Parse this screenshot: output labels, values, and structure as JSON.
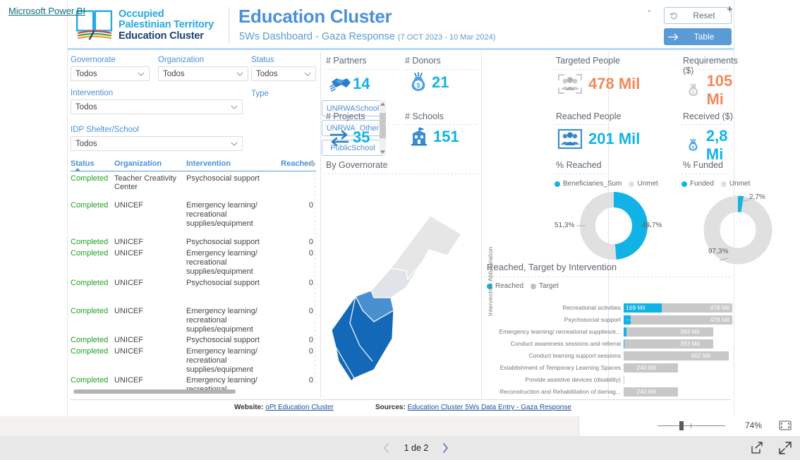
{
  "header": {
    "logo": {
      "line1": "Occupied",
      "line2": "Palestinian Territory",
      "line3": "Education Cluster",
      "icon": "open-book-icon"
    },
    "title": "Education Cluster",
    "subtitle": "5Ws Dashboard - Gaza Response",
    "date_range": "(7 OCT 2023 - 10 Mar 2024)",
    "buttons": {
      "reset": {
        "label": "Reset",
        "icon": "undo-arrow-icon"
      },
      "table": {
        "label": "Table",
        "icon": "right-arrow-icon"
      }
    },
    "colors": {
      "title": "#4a90d9",
      "logo_cyan": "#29a8e0",
      "logo_navy": "#1b3f78"
    }
  },
  "filters": {
    "governorate": {
      "label": "Governorate",
      "value": "Todos"
    },
    "organization": {
      "label": "Organization",
      "value": "Todos"
    },
    "status": {
      "label": "Status",
      "value": "Todos"
    },
    "intervention": {
      "label": "Intervention",
      "value": "Todos"
    },
    "idp_shelter_school": {
      "label": "IDP Shelter/School",
      "value": "Todos"
    },
    "type": {
      "label": "Type",
      "options": [
        "UNRWASchool",
        "UNRWA_Other",
        "PublicSchool"
      ]
    }
  },
  "table": {
    "columns": [
      "Status",
      "Organization",
      "Intervention",
      "Reached"
    ],
    "sort_column": "Status",
    "sort_direction": "asc",
    "rows": [
      {
        "status": "Completed",
        "organization": "Teacher Creativity Center",
        "intervention": "Psychosocial support",
        "reached": ""
      },
      {
        "status": "Completed",
        "organization": "UNICEF",
        "intervention": "Emergency learning/ recreational supplies/equipment",
        "reached": "0"
      },
      {
        "status": "Completed",
        "organization": "UNICEF",
        "intervention": "Psychosocial support",
        "reached": "0"
      },
      {
        "status": "Completed",
        "organization": "UNICEF",
        "intervention": "Emergency learning/ recreational supplies/equipment",
        "reached": "0"
      },
      {
        "status": "Completed",
        "organization": "UNICEF",
        "intervention": "Psychosocial support",
        "reached": "0"
      },
      {
        "status": "Completed",
        "organization": "UNICEF",
        "intervention": "Emergency learning/ recreational supplies/equipment",
        "reached": "0"
      },
      {
        "status": "Completed",
        "organization": "UNICEF",
        "intervention": "Psychosocial support",
        "reached": "0"
      },
      {
        "status": "Completed",
        "organization": "UNICEF",
        "intervention": "Emergency learning/ recreational supplies/equipment",
        "reached": "0"
      },
      {
        "status": "Completed",
        "organization": "UNICEF",
        "intervention": "Emergency learning/ recreational",
        "reached": "0"
      }
    ]
  },
  "kpis": {
    "partners": {
      "label": "# Partners",
      "value": "14",
      "icon": "handshake-icon",
      "color": "#11b3e6"
    },
    "donors": {
      "label": "# Donors",
      "value": "21",
      "icon": "money-bag-icon",
      "color": "#11b3e6"
    },
    "projects": {
      "label": "# Projects",
      "value": "35",
      "icon": "exchange-arrows-icon",
      "color": "#11b3e6"
    },
    "schools": {
      "label": "# Schools",
      "value": "151",
      "icon": "school-building-icon",
      "color": "#11b3e6"
    },
    "targeted": {
      "label": "Targeted People",
      "value": "478 Mil",
      "icon": "people-target-icon",
      "color": "#f08a5d"
    },
    "reached": {
      "label": "Reached People",
      "value": "201 Mil",
      "icon": "people-filled-icon",
      "color": "#11b3e6"
    },
    "requirements": {
      "label": "Requirements ($)",
      "value": "105 Mi",
      "icon": "money-bag-grey-icon",
      "color": "#f08a5d"
    },
    "received": {
      "label": "Received ($)",
      "value": "2,8 Mi",
      "icon": "money-bag-blue-icon",
      "color": "#11b3e6"
    }
  },
  "map": {
    "title": "By Governorate",
    "region": "gaza-strip"
  },
  "chart_data": [
    {
      "id": "pct_reached",
      "type": "pie",
      "title": "% Reached",
      "legend": [
        "Beneficiaries_Sum",
        "Unmet"
      ],
      "legend_position": "top",
      "categories": [
        "Beneficiaries_Sum",
        "Unmet"
      ],
      "values": [
        48.7,
        51.3
      ],
      "labels": [
        "48,7%",
        "51,3%"
      ],
      "colors": [
        "#11b3e6",
        "#e0e0e0"
      ]
    },
    {
      "id": "pct_funded",
      "type": "pie",
      "title": "% Funded",
      "legend": [
        "Funded",
        "Unmet"
      ],
      "legend_position": "top",
      "categories": [
        "Funded",
        "Unmet"
      ],
      "values": [
        2.7,
        97.3
      ],
      "labels": [
        "2,7%",
        "97,3%"
      ],
      "colors": [
        "#11b3e6",
        "#e0e0e0"
      ]
    },
    {
      "id": "reached_target_by_intervention",
      "type": "bar",
      "title": "Reached, Target by Intervention",
      "legend": [
        "Reached",
        "Target"
      ],
      "legend_position": "top",
      "ylabel": "Intervention Abbreviation",
      "xlabel": "",
      "colors": {
        "reached": "#11b3e6",
        "target": "#c8c8c8"
      },
      "categories": [
        "Recreational activities",
        "Psychosocial support",
        "Emergency learning/ recreational supplies/e...",
        "Conduct awareness sessions and referral",
        "Conduct learning support sessions",
        "Establishment of Temporary Learning Spaces",
        "Provide assistive devices (disability)",
        "Reconstruction and Rehabilitation of damag..."
      ],
      "series": [
        {
          "name": "Target",
          "values": [
            478,
            478,
            393,
            393,
            462,
            240,
            2,
            240
          ],
          "labels": [
            "478 Mil",
            "478 Mil",
            "393 Mil",
            "393 Mil",
            "462 Mil",
            "240 Mil",
            "",
            "240 Mil"
          ]
        },
        {
          "name": "Reached",
          "values": [
            169,
            32,
            14,
            3,
            0,
            0,
            0,
            0
          ],
          "labels": [
            "169 Mil",
            "...",
            "",
            "",
            "",
            "",
            "",
            ""
          ]
        }
      ],
      "xlim": [
        0,
        478
      ],
      "unit": "Mil"
    }
  ],
  "section_titles": {
    "pct_reached": "% Reached",
    "pct_funded": "% Funded",
    "bars": "Reached, Target by Intervention"
  },
  "footer": {
    "website_label": "Website:",
    "website_link": "oPt Education Cluster",
    "sources_label": "Sources:",
    "sources_link": "Education Cluster 5Ws Data Entry - Gaza Response"
  },
  "statusbar": {
    "zoom_out": "-",
    "zoom_in": "+",
    "zoom_level": "74%",
    "fit_icon": "fit-to-page-icon"
  },
  "appbar": {
    "brand": "Microsoft Power BI",
    "page_indicator": "1 de 2",
    "prev_icon": "chevron-left-icon",
    "next_icon": "chevron-right-icon",
    "share_icon": "share-icon",
    "fullscreen_icon": "expand-icon"
  }
}
